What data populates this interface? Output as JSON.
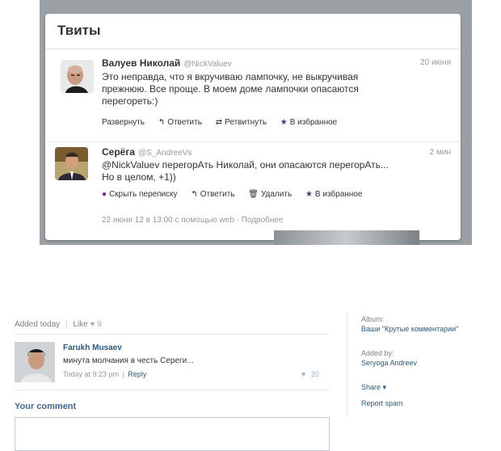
{
  "twitter": {
    "heading": "Твиты",
    "tweets": [
      {
        "name": "Валуев Николай",
        "handle": "@NickValuev",
        "time": "20 июня",
        "lines": [
          "Это неправда, что я вкручиваю лампочку, не выкручивая",
          "прежнюю. Все проще. В моем доме лампочки опасаются",
          "перегореть:)"
        ],
        "actions": [
          {
            "icon": "",
            "label": "Развернуть"
          },
          {
            "icon": "↰",
            "label": "Ответить"
          },
          {
            "icon": "⇄",
            "label": "Ретвитнуть"
          },
          {
            "icon": "★",
            "label": "В избранное"
          }
        ]
      },
      {
        "name": "Серёга",
        "handle": "@S_AndreeVs",
        "time": "2 мин",
        "lines": [
          "@NickValuev перегорАть Николай, они опасаются перегорАть...",
          "Но в целом, +1))"
        ],
        "actions": [
          {
            "icon": "●",
            "label": "Скрыть переписку"
          },
          {
            "icon": "↰",
            "label": "Ответить"
          },
          {
            "icon": "🗑",
            "label": "Удалить"
          },
          {
            "icon": "★",
            "label": "В избранное"
          }
        ],
        "meta": "22 июня 12 в 13:00 с помощью web · Подробнее"
      }
    ]
  },
  "vk": {
    "added": "Added today",
    "sep": "|",
    "like_label": "Like",
    "like_heart": "♥",
    "likes": "9",
    "comment": {
      "author": "Farukh Musaev",
      "text": "минута молчания в честь Сереги...",
      "time": "Today at 9:23 pm",
      "reply": "Reply",
      "heart": "♥",
      "likes": "20"
    },
    "your_comment": "Your comment",
    "sidebar": {
      "album_label": "Album:",
      "album_value": "Ваши \"Крутые комментарии\"",
      "addedby_label": "Added by:",
      "addedby_value": "Seryoga Andreev",
      "share": "Share",
      "share_arrow": "▾",
      "report": "Report spam"
    }
  }
}
